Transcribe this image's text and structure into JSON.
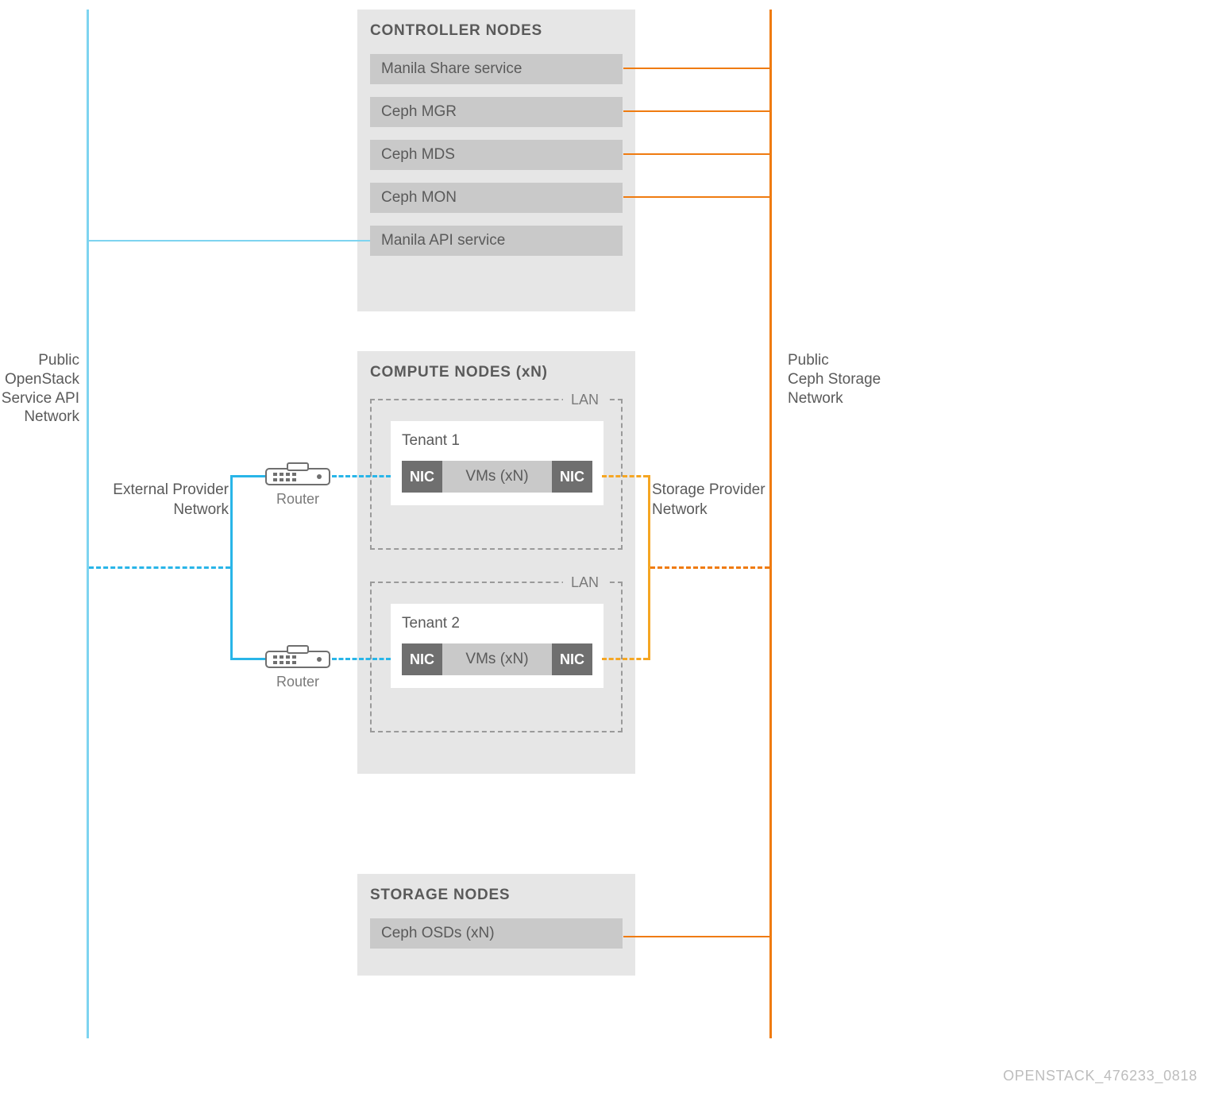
{
  "networks": {
    "left_label": "Public\nOpenStack\nService API\nNetwork",
    "right_label": "Public\nCeph Storage\nNetwork",
    "external_provider": "External Provider\nNetwork",
    "storage_provider": "Storage Provider\nNetwork"
  },
  "controller": {
    "title": "CONTROLLER NODES",
    "services": [
      "Manila Share service",
      "Ceph MGR",
      "Ceph MDS",
      "Ceph MON",
      "Manila API service"
    ]
  },
  "compute": {
    "title": "COMPUTE NODES  (xN)",
    "lan_tag": "LAN",
    "tenants": [
      {
        "name": "Tenant 1",
        "nic": "NIC",
        "vms": "VMs  (xN)"
      },
      {
        "name": "Tenant 2",
        "nic": "NIC",
        "vms": "VMs  (xN)"
      }
    ]
  },
  "storage": {
    "title": "STORAGE NODES",
    "services": [
      "Ceph OSDs  (xN)"
    ]
  },
  "router_label": "Router",
  "footer_id": "OPENSTACK_476233_0818",
  "colors": {
    "light_blue": "#7ed4f0",
    "cyan": "#29b5e8",
    "orange": "#ef7b10",
    "amber": "#f5a623",
    "panel_bg": "#e6e6e6",
    "row_bg": "#c9c9c9",
    "nic_bg": "#6f6f6f"
  }
}
